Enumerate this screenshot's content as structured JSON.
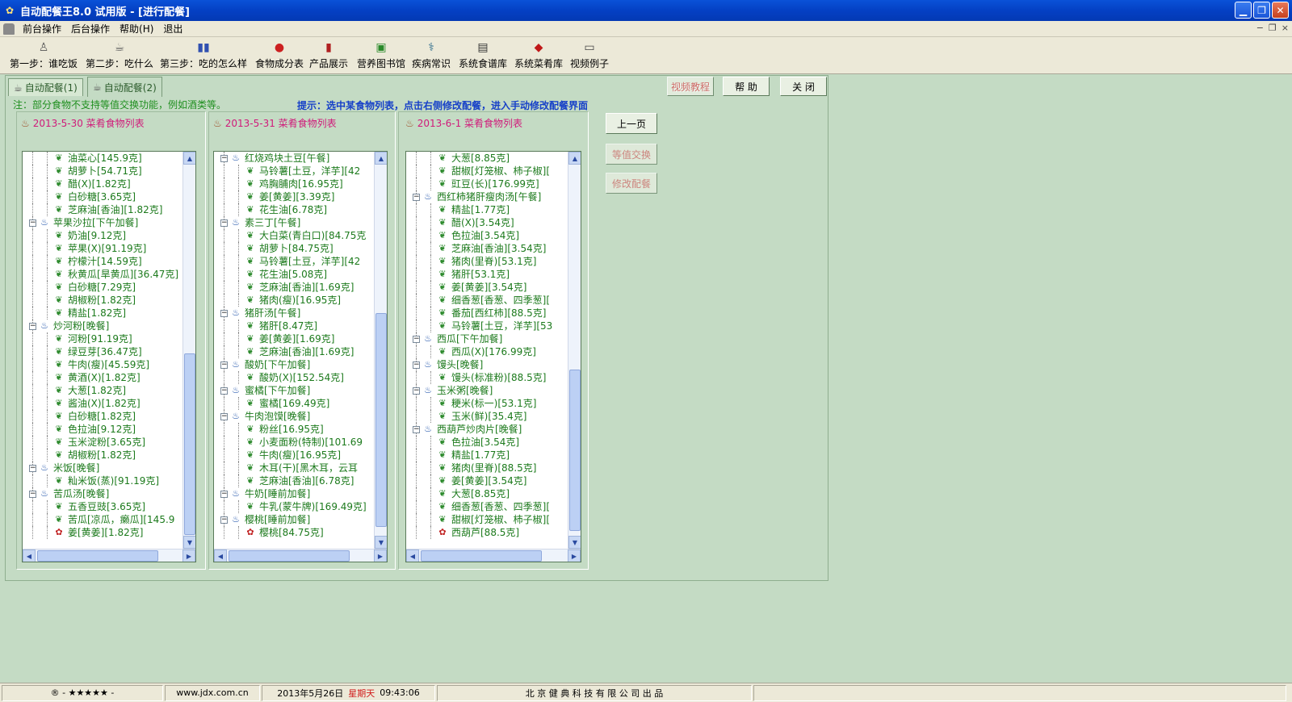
{
  "window": {
    "title": "自动配餐王8.0 试用版 - [进行配餐]"
  },
  "menu": [
    "前台操作",
    "后台操作",
    "帮助(H)",
    "退出"
  ],
  "toolbar": [
    {
      "label": "第一步：谁吃饭",
      "icon": "person-icon"
    },
    {
      "label": "第二步：吃什么",
      "icon": "pot-icon"
    },
    {
      "label": "第三步：吃的怎么样",
      "icon": "chart-icon"
    },
    {
      "label": "食物成分表",
      "icon": "apple-icon"
    },
    {
      "label": "产品展示",
      "icon": "bottle-icon"
    },
    {
      "label": "营养图书馆",
      "icon": "book-icon"
    },
    {
      "label": "疾病常识",
      "icon": "medical-icon"
    },
    {
      "label": "系统食谱库",
      "icon": "recipe-book-icon"
    },
    {
      "label": "系统菜肴库",
      "icon": "dish-book-icon"
    },
    {
      "label": "视频例子",
      "icon": "video-icon"
    }
  ],
  "tabs": [
    "自动配餐(1)",
    "自动配餐(2)"
  ],
  "top_buttons": {
    "video": "视频教程",
    "help": "帮 助",
    "close": "关 闭"
  },
  "note": "注：部分食物不支持等值交换功能，例如酒类等。",
  "hint": "提示：选中某食物列表，点击右侧修改配餐，进入手动修改配餐界面",
  "side_buttons": {
    "prev": "上一页",
    "equal": "等值交换",
    "modify": "修改配餐"
  },
  "days": [
    {
      "header": "2013-5-30  菜肴食物列表",
      "rows": [
        {
          "t": "油菜心[145.9克]",
          "k": "food"
        },
        {
          "t": "胡萝卜[54.71克]",
          "k": "food"
        },
        {
          "t": "醋(X)[1.82克]",
          "k": "food"
        },
        {
          "t": "白砂糖[3.65克]",
          "k": "food"
        },
        {
          "t": "芝麻油[香油][1.82克]",
          "k": "food"
        },
        {
          "t": "苹果沙拉[下午加餐]",
          "k": "meal"
        },
        {
          "t": "奶油[9.12克]",
          "k": "food"
        },
        {
          "t": "苹果(X)[91.19克]",
          "k": "food"
        },
        {
          "t": "柠檬汁[14.59克]",
          "k": "food"
        },
        {
          "t": "秋黄瓜[旱黄瓜][36.47克]",
          "k": "food"
        },
        {
          "t": "白砂糖[7.29克]",
          "k": "food"
        },
        {
          "t": "胡椒粉[1.82克]",
          "k": "food"
        },
        {
          "t": "精盐[1.82克]",
          "k": "food"
        },
        {
          "t": "炒河粉[晚餐]",
          "k": "meal"
        },
        {
          "t": "河粉[91.19克]",
          "k": "food"
        },
        {
          "t": "绿豆芽[36.47克]",
          "k": "food"
        },
        {
          "t": "牛肉(瘦)[45.59克]",
          "k": "food"
        },
        {
          "t": "黄酒(X)[1.82克]",
          "k": "food"
        },
        {
          "t": "大葱[1.82克]",
          "k": "food"
        },
        {
          "t": "酱油(X)[1.82克]",
          "k": "food"
        },
        {
          "t": "白砂糖[1.82克]",
          "k": "food"
        },
        {
          "t": "色拉油[9.12克]",
          "k": "food"
        },
        {
          "t": "玉米淀粉[3.65克]",
          "k": "food"
        },
        {
          "t": "胡椒粉[1.82克]",
          "k": "food"
        },
        {
          "t": "米饭[晚餐]",
          "k": "meal"
        },
        {
          "t": "籼米饭(蒸)[91.19克]",
          "k": "food"
        },
        {
          "t": "苦瓜汤[晚餐]",
          "k": "meal"
        },
        {
          "t": "五香豆豉[3.65克]",
          "k": "food"
        },
        {
          "t": "苦瓜[凉瓜，癞瓜][145.9",
          "k": "food"
        },
        {
          "t": "姜[黄姜][1.82克]",
          "k": "fruit"
        }
      ]
    },
    {
      "header": "2013-5-31  菜肴食物列表",
      "rows": [
        {
          "t": "红烧鸡块土豆[午餐]",
          "k": "meal"
        },
        {
          "t": "马铃薯[土豆，洋芋][42",
          "k": "food"
        },
        {
          "t": "鸡胸脯肉[16.95克]",
          "k": "food"
        },
        {
          "t": "姜[黄姜][3.39克]",
          "k": "food"
        },
        {
          "t": "花生油[6.78克]",
          "k": "food"
        },
        {
          "t": "素三丁[午餐]",
          "k": "meal"
        },
        {
          "t": "大白菜(青白口)[84.75克",
          "k": "food"
        },
        {
          "t": "胡萝卜[84.75克]",
          "k": "food"
        },
        {
          "t": "马铃薯[土豆，洋芋][42",
          "k": "food"
        },
        {
          "t": "花生油[5.08克]",
          "k": "food"
        },
        {
          "t": "芝麻油[香油][1.69克]",
          "k": "food"
        },
        {
          "t": "猪肉(瘦)[16.95克]",
          "k": "food"
        },
        {
          "t": "猪肝汤[午餐]",
          "k": "meal"
        },
        {
          "t": "猪肝[8.47克]",
          "k": "food"
        },
        {
          "t": "姜[黄姜][1.69克]",
          "k": "food"
        },
        {
          "t": "芝麻油[香油][1.69克]",
          "k": "food"
        },
        {
          "t": "酸奶[下午加餐]",
          "k": "meal"
        },
        {
          "t": "酸奶(X)[152.54克]",
          "k": "food"
        },
        {
          "t": "蜜橘[下午加餐]",
          "k": "meal"
        },
        {
          "t": "蜜橘[169.49克]",
          "k": "food"
        },
        {
          "t": "牛肉泡馍[晚餐]",
          "k": "meal"
        },
        {
          "t": "粉丝[16.95克]",
          "k": "food"
        },
        {
          "t": "小麦面粉(特制)[101.69",
          "k": "food"
        },
        {
          "t": "牛肉(瘦)[16.95克]",
          "k": "food"
        },
        {
          "t": "木耳(干)[黑木耳，云耳",
          "k": "food"
        },
        {
          "t": "芝麻油[香油][6.78克]",
          "k": "food"
        },
        {
          "t": "牛奶[睡前加餐]",
          "k": "meal"
        },
        {
          "t": "牛乳(蒙牛牌)[169.49克]",
          "k": "food"
        },
        {
          "t": "樱桃[睡前加餐]",
          "k": "meal"
        },
        {
          "t": "樱桃[84.75克]",
          "k": "fruit"
        }
      ]
    },
    {
      "header": "2013-6-1  菜肴食物列表",
      "rows": [
        {
          "t": "大葱[8.85克]",
          "k": "food"
        },
        {
          "t": "甜椒[灯笼椒、柿子椒][",
          "k": "food"
        },
        {
          "t": "豇豆(长)[176.99克]",
          "k": "food"
        },
        {
          "t": "西红柿猪肝瘦肉汤[午餐]",
          "k": "meal"
        },
        {
          "t": "精盐[1.77克]",
          "k": "food"
        },
        {
          "t": "醋(X)[3.54克]",
          "k": "food"
        },
        {
          "t": "色拉油[3.54克]",
          "k": "food"
        },
        {
          "t": "芝麻油[香油][3.54克]",
          "k": "food"
        },
        {
          "t": "猪肉(里脊)[53.1克]",
          "k": "food"
        },
        {
          "t": "猪肝[53.1克]",
          "k": "food"
        },
        {
          "t": "姜[黄姜][3.54克]",
          "k": "food"
        },
        {
          "t": "细香葱[香葱、四季葱][",
          "k": "food"
        },
        {
          "t": "番茄[西红柿][88.5克]",
          "k": "food"
        },
        {
          "t": "马铃薯[土豆，洋芋][53",
          "k": "food"
        },
        {
          "t": "西瓜[下午加餐]",
          "k": "meal"
        },
        {
          "t": "西瓜(X)[176.99克]",
          "k": "food"
        },
        {
          "t": "馒头[晚餐]",
          "k": "meal"
        },
        {
          "t": "馒头(标准粉)[88.5克]",
          "k": "food"
        },
        {
          "t": "玉米粥[晚餐]",
          "k": "meal"
        },
        {
          "t": "粳米(标一)[53.1克]",
          "k": "food"
        },
        {
          "t": "玉米(鲜)[35.4克]",
          "k": "food"
        },
        {
          "t": "西葫芦炒肉片[晚餐]",
          "k": "meal"
        },
        {
          "t": "色拉油[3.54克]",
          "k": "food"
        },
        {
          "t": "精盐[1.77克]",
          "k": "food"
        },
        {
          "t": "猪肉(里脊)[88.5克]",
          "k": "food"
        },
        {
          "t": "姜[黄姜][3.54克]",
          "k": "food"
        },
        {
          "t": "大葱[8.85克]",
          "k": "food"
        },
        {
          "t": "细香葱[香葱、四季葱][",
          "k": "food"
        },
        {
          "t": "甜椒[灯笼椒、柿子椒][",
          "k": "food"
        },
        {
          "t": "西葫芦[88.5克]",
          "k": "fruit"
        }
      ]
    }
  ],
  "status": {
    "stars": "® - ★★★★★ -",
    "url": "www.jdx.com.cn",
    "date": "2013年5月26日",
    "weekday": "星期天",
    "time": "09:43:06",
    "company": "北 京 健 典 科 技 有 限 公 司   出 品"
  },
  "colors": {
    "accent_green": "#c4dbc4",
    "title_blue": "#0440c4",
    "header_pink": "#d01a7a",
    "hint_blue": "#1640c8"
  }
}
